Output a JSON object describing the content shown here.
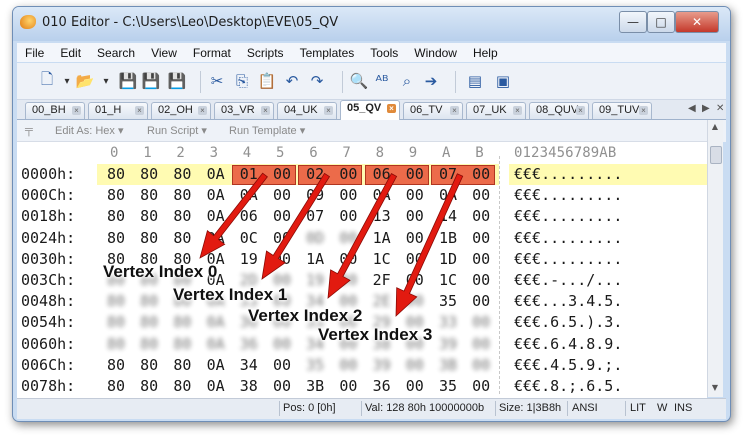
{
  "window": {
    "title": "010 Editor - C:\\Users\\Leo\\Desktop\\EVE\\05_QV",
    "controls": {
      "minimize": "—",
      "maximize": "□",
      "close": "✕"
    }
  },
  "menu": [
    "File",
    "Edit",
    "Search",
    "View",
    "Format",
    "Scripts",
    "Templates",
    "Tools",
    "Window",
    "Help"
  ],
  "toolbar_icons": [
    "new-file-icon",
    "dropdown-icon",
    "open-folder-icon",
    "dropdown-icon",
    "save-icon",
    "save-as-icon",
    "save-all-icon",
    "cut-icon",
    "copy-icon",
    "paste-icon",
    "undo-icon",
    "redo-icon",
    "find-icon",
    "replace-icon",
    "find-in-files-icon",
    "goto-icon",
    "select-range-icon",
    "bookmark-icon"
  ],
  "tabs": [
    {
      "label": "00_BH",
      "active": false
    },
    {
      "label": "01_H",
      "active": false
    },
    {
      "label": "02_OH",
      "active": false
    },
    {
      "label": "03_VR",
      "active": false
    },
    {
      "label": "04_UK",
      "active": false
    },
    {
      "label": "05_QV",
      "active": true
    },
    {
      "label": "06_TV",
      "active": false
    },
    {
      "label": "07_UK",
      "active": false
    },
    {
      "label": "08_QUV",
      "active": false
    },
    {
      "label": "09_TUV",
      "active": false
    }
  ],
  "tab_nav": {
    "prev": "◀",
    "next": "▶",
    "close": "✕"
  },
  "panelbar": {
    "pin": "╤",
    "edit_as": "Edit As: Hex ▾",
    "run_script": "Run Script ▾",
    "run_template": "Run Template ▾"
  },
  "hex": {
    "columns": [
      "0",
      "1",
      "2",
      "3",
      "4",
      "5",
      "6",
      "7",
      "8",
      "9",
      "A",
      "B"
    ],
    "ascii_header": "0123456789AB",
    "rows": [
      {
        "addr": "0000h:",
        "bytes": [
          "80",
          "80",
          "80",
          "0A",
          "01",
          "00",
          "02",
          "00",
          "06",
          "00",
          "07",
          "00"
        ],
        "ascii": "€€€........."
      },
      {
        "addr": "000Ch:",
        "bytes": [
          "80",
          "80",
          "80",
          "0A",
          "0A",
          "00",
          "09",
          "00",
          "0A",
          "00",
          "0A",
          "00"
        ],
        "ascii": "€€€........."
      },
      {
        "addr": "0018h:",
        "bytes": [
          "80",
          "80",
          "80",
          "0A",
          "06",
          "00",
          "07",
          "00",
          "13",
          "00",
          "14",
          "00"
        ],
        "ascii": "€€€........."
      },
      {
        "addr": "0024h:",
        "bytes": [
          "80",
          "80",
          "80",
          "0A",
          "0C",
          "00",
          "0D",
          "00",
          "1A",
          "00",
          "1B",
          "00"
        ],
        "ascii": "€€€........."
      },
      {
        "addr": "0030h:",
        "bytes": [
          "80",
          "80",
          "80",
          "0A",
          "19",
          "00",
          "1A",
          "00",
          "1C",
          "00",
          "1D",
          "00"
        ],
        "ascii": "€€€........."
      },
      {
        "addr": "003Ch:",
        "bytes": [
          "80",
          "80",
          "80",
          "0A",
          "2D",
          "00",
          "19",
          "00",
          "2F",
          "00",
          "1C",
          "00"
        ],
        "ascii": "€€€.-.../..."
      },
      {
        "addr": "0048h:",
        "bytes": [
          "80",
          "80",
          "80",
          "0A",
          "33",
          "00",
          "34",
          "00",
          "2E",
          "00",
          "35",
          "00"
        ],
        "ascii": "€€€...3.4.5."
      },
      {
        "addr": "0054h:",
        "bytes": [
          "80",
          "80",
          "80",
          "0A",
          "36",
          "00",
          "35",
          "00",
          "29",
          "00",
          "33",
          "00"
        ],
        "ascii": "€€€.6.5.).3."
      },
      {
        "addr": "0060h:",
        "bytes": [
          "80",
          "80",
          "80",
          "0A",
          "36",
          "00",
          "34",
          "00",
          "38",
          "00",
          "39",
          "00"
        ],
        "ascii": "€€€.6.4.8.9."
      },
      {
        "addr": "006Ch:",
        "bytes": [
          "80",
          "80",
          "80",
          "0A",
          "34",
          "00",
          "35",
          "00",
          "39",
          "00",
          "3B",
          "00"
        ],
        "ascii": "€€€.4.5.9.;."
      },
      {
        "addr": "0078h:",
        "bytes": [
          "80",
          "80",
          "80",
          "0A",
          "38",
          "00",
          "3B",
          "00",
          "36",
          "00",
          "35",
          "00"
        ],
        "ascii": "€€€.8.;.6.5."
      }
    ]
  },
  "annotations": [
    "Vertex Index 0",
    "Vertex Index 1",
    "Vertex Index 2",
    "Vertex Index 3"
  ],
  "status": {
    "pos": "Pos: 0 [0h]",
    "val": "Val: 128 80h 10000000b",
    "size": "Size: 1|3B8h",
    "encoding": "ANSI",
    "endian": "LIT",
    "mode": "W",
    "ins": "INS"
  },
  "colors": {
    "highlight": "#ec6b4a",
    "current_row": "#fffbb2",
    "arrow": "#e21a10"
  }
}
